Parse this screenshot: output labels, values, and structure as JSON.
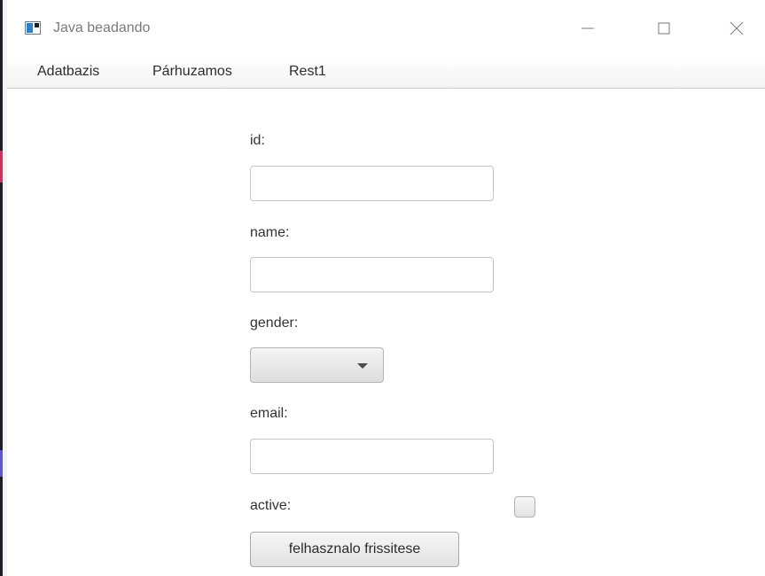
{
  "window": {
    "title": "Java beadando"
  },
  "menubar": {
    "items": [
      {
        "label": "Adatbazis"
      },
      {
        "label": "Párhuzamos"
      },
      {
        "label": "Rest1"
      }
    ]
  },
  "form": {
    "id_label": "id:",
    "id_value": "",
    "name_label": "name:",
    "name_value": "",
    "gender_label": "gender:",
    "gender_value": "",
    "email_label": "email:",
    "email_value": "",
    "active_label": "active:",
    "active_checked": false,
    "submit_label": "felhasznalo frissitese"
  },
  "icons": {
    "app": "java-app-icon",
    "minimize": "minimize-icon",
    "maximize": "maximize-icon",
    "close": "close-icon",
    "dropdown": "chevron-down-icon"
  },
  "colors": {
    "title_text": "#7a7a7a",
    "menu_text": "#2c2c2c",
    "label_text": "#333333",
    "field_border": "#c4c4c4"
  }
}
